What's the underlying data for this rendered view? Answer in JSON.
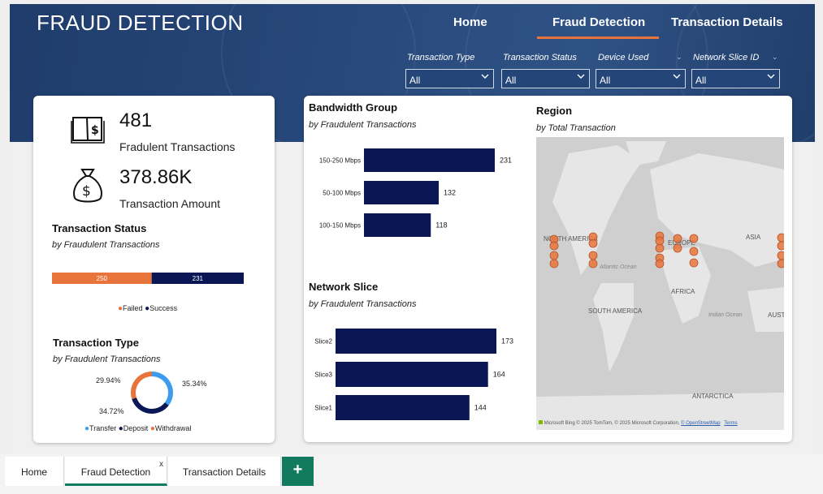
{
  "header": {
    "title": "FRAUD DETECTION",
    "nav": [
      "Home",
      "Fraud Detection",
      "Transaction Details"
    ],
    "active_nav": "Fraud Detection"
  },
  "filters": [
    {
      "label": "Transaction Type",
      "value": "All"
    },
    {
      "label": "Transaction Status",
      "value": "All"
    },
    {
      "label": "Device Used",
      "value": "All"
    },
    {
      "label": "Network Slice ID",
      "value": "All"
    }
  ],
  "kpis": {
    "fraud_count": {
      "value": "481",
      "label": "Fradulent Transactions",
      "icon": "book-dollar-icon"
    },
    "amount": {
      "value": "378.86K",
      "label": "Transaction Amount",
      "icon": "money-bag-icon"
    }
  },
  "status": {
    "title": "Transaction Status",
    "subtitle": "by Fraudulent Transactions",
    "legend": [
      "Failed",
      "Success"
    ]
  },
  "type": {
    "title": "Transaction Type",
    "subtitle": "by Fraudulent Transactions",
    "pct_labels": [
      "29.94%",
      "35.34%",
      "34.72%"
    ],
    "legend": [
      "Transfer",
      "Deposit",
      "Withdrawal"
    ]
  },
  "bandwidth": {
    "title": "Bandwidth Group",
    "subtitle": "by Fraudulent Transactions"
  },
  "slice": {
    "title": "Network Slice",
    "subtitle": "by Fraudulent Transactions"
  },
  "region": {
    "title": "Region",
    "subtitle": "by Total Transaction",
    "labels": [
      "NORTH AMERICA",
      "EUROPE",
      "ASIA",
      "AFRICA",
      "SOUTH AMERICA",
      "Atlantic Ocean",
      "Indian Ocean",
      "AUST",
      "ANTARCTICA"
    ],
    "attribution": "© 2025 TomTom, © 2025 Microsoft Corporation,",
    "osm": "© OpenStreetMap",
    "terms": "Terms",
    "brand": "Microsoft Bing"
  },
  "colors": {
    "navy": "#0b1754",
    "orange": "#e8743b",
    "blue": "#3b9cf0",
    "teal": "#127a5e"
  },
  "tabs": [
    "Home",
    "Fraud Detection",
    "Transaction Details"
  ],
  "tab_close": "x",
  "add_tab": "+",
  "chart_data": [
    {
      "type": "bar",
      "orientation": "horizontal",
      "title": "Bandwidth Group",
      "subtitle": "by Fraudulent Transactions",
      "categories": [
        "150-250 Mbps",
        "50-100 Mbps",
        "100-150 Mbps"
      ],
      "values": [
        231,
        132,
        118
      ],
      "xlim": [
        0,
        231
      ]
    },
    {
      "type": "bar",
      "orientation": "horizontal",
      "title": "Network Slice",
      "subtitle": "by Fraudulent Transactions",
      "categories": [
        "Slice2",
        "Slice3",
        "Slice1"
      ],
      "values": [
        173,
        164,
        144
      ],
      "xlim": [
        0,
        173
      ]
    },
    {
      "type": "bar",
      "orientation": "horizontal-stacked",
      "title": "Transaction Status",
      "subtitle": "by Fraudulent Transactions",
      "series": [
        {
          "name": "Failed",
          "values": [
            250
          ]
        },
        {
          "name": "Success",
          "values": [
            231
          ]
        }
      ]
    },
    {
      "type": "pie",
      "style": "donut",
      "title": "Transaction Type",
      "subtitle": "by Fraudulent Transactions",
      "categories": [
        "Transfer",
        "Deposit",
        "Withdrawal"
      ],
      "values": [
        35.34,
        34.72,
        29.94
      ]
    }
  ]
}
